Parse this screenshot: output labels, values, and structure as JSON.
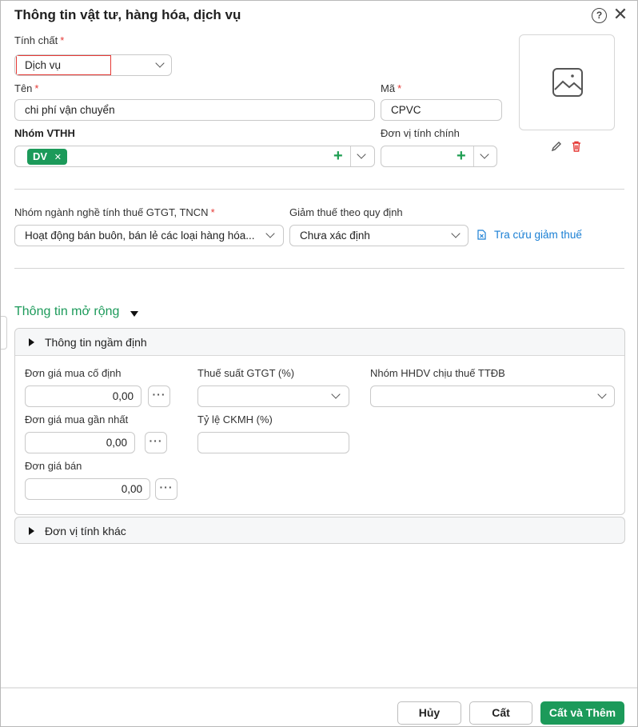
{
  "dialog": {
    "title": "Thông tin vật tư, hàng hóa, dịch vụ",
    "help_icon": "question-circle-icon",
    "close_icon": "close-icon",
    "help_glyph": "?",
    "close_glyph": "✕"
  },
  "form": {
    "tinh_chat": {
      "label": "Tính chất",
      "required": "*",
      "value": "Dịch vụ"
    },
    "ten": {
      "label": "Tên",
      "required": "*",
      "value": "chi phí vận chuyển"
    },
    "ma": {
      "label": "Mã",
      "required": "*",
      "value": "CPVC"
    },
    "nhom_vthh": {
      "label": "Nhóm VTHH",
      "tag": "DV",
      "tag_remove": "✕",
      "add": "+"
    },
    "don_vi_tinh_chinh": {
      "label": "Đơn vị tính chính",
      "value": "",
      "add": "+"
    },
    "nhom_nganh_nghe": {
      "label": "Nhóm ngành nghề tính thuế GTGT, TNCN",
      "required": "*",
      "value": "Hoạt động bán buôn, bán lẻ các loại hàng hóa..."
    },
    "giam_thue": {
      "label": "Giảm thuế theo quy định",
      "value": "Chưa xác định"
    },
    "tra_cuu_link": "Tra cứu giảm thuế"
  },
  "image": {
    "placeholder_icon": "image-placeholder-icon",
    "edit_icon": "pencil-icon",
    "delete_icon": "trash-icon"
  },
  "extended": {
    "title": "Thông tin mở rộng",
    "default_panel": {
      "title": "Thông tin ngầm định",
      "don_gia_mua_co_dinh": {
        "label": "Đơn giá mua cố định",
        "value": "0,00"
      },
      "don_gia_mua_gan_nhat": {
        "label": "Đơn giá mua gần nhất",
        "value": "0,00"
      },
      "don_gia_ban": {
        "label": "Đơn giá bán",
        "value": "0,00"
      },
      "thue_suat_gtgt": {
        "label": "Thuế suất GTGT (%)",
        "value": ""
      },
      "ty_le_ckmh": {
        "label": "Tỷ lệ CKMH (%)",
        "value": ""
      },
      "nhom_hhdv_ttdb": {
        "label": "Nhóm HHDV chịu thuế TTĐB",
        "value": ""
      },
      "more": "···"
    },
    "units_panel": {
      "title": "Đơn vị tính khác"
    }
  },
  "footer": {
    "cancel_label": "Hủy",
    "save_label": "Cất",
    "save_add_label": "Cất và Thêm"
  }
}
